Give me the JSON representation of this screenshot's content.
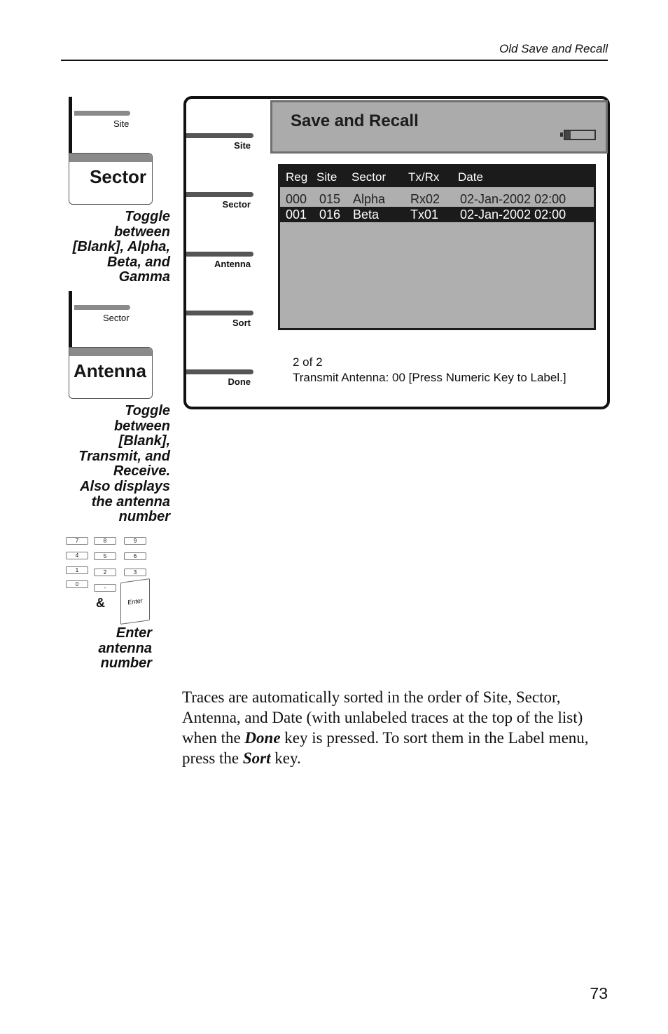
{
  "running_head": "Old Save and Recall",
  "page_number": "73",
  "illustrations": {
    "sector_key": {
      "small_label": "Site",
      "big_label": "Sector",
      "caption": [
        "Toggle",
        "between",
        "[Blank], Alpha,",
        "Beta, and",
        "Gamma"
      ]
    },
    "antenna_key": {
      "small_label": "Sector",
      "big_label": "Antenna",
      "caption": [
        "Toggle",
        "between",
        "[Blank],",
        "Transmit, and",
        "Receive.",
        "Also displays",
        "the antenna",
        "number"
      ]
    },
    "keypad": {
      "keys": [
        "7",
        "8",
        "9",
        "4",
        "5",
        "6",
        "1",
        "2",
        "3",
        "0",
        "-"
      ],
      "enter_label": "Enter",
      "ampersand": "&",
      "caption": [
        "Enter",
        "antenna",
        "number"
      ]
    }
  },
  "screen": {
    "title": "Save and Recall",
    "battery_level": 0.2,
    "softkeys": [
      {
        "label": "Site"
      },
      {
        "label": "Sector"
      },
      {
        "label": "Antenna"
      },
      {
        "label": "Sort"
      },
      {
        "label": "Done"
      }
    ],
    "table": {
      "columns": [
        "Reg",
        "Site",
        "Sector",
        "Tx/Rx",
        "Date"
      ],
      "rows": [
        {
          "reg": "000",
          "site": "015",
          "sector": "Alpha",
          "txrx": "Rx02",
          "date": "02-Jan-2002 02:00",
          "selected": false
        },
        {
          "reg": "001",
          "site": "016",
          "sector": "Beta",
          "txrx": "Tx01",
          "date": "02-Jan-2002 02:00",
          "selected": true
        }
      ]
    },
    "status_count": "2 of 2",
    "status_message": "Transmit Antenna: 00 [Press Numeric Key to Label.]"
  },
  "body": {
    "p1": "Traces are automatically sorted in the order of Site, Sector, Antenna, and Date (with unlabeled traces at the top of the list) when the ",
    "em1": "Done",
    "p2": " key is pressed. To sort them in the Label menu, press the ",
    "em2": "Sort",
    "p3": " key."
  },
  "colors": {
    "screen_panel_gray": "#ababab",
    "selection_black": "#1b1b1b"
  }
}
